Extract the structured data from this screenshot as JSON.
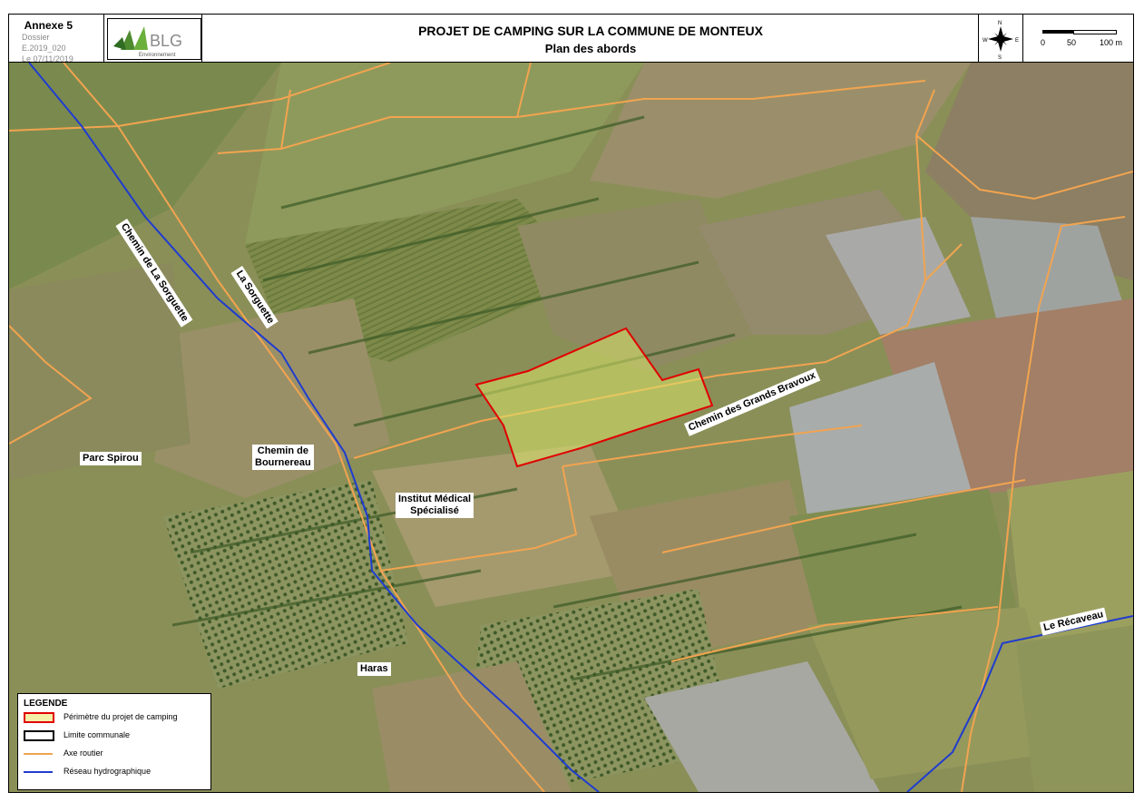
{
  "header": {
    "annex": "Annexe 5",
    "dossier": "Dossier E.2019_020",
    "date": "Le 07/11/2019",
    "logo_text": "BLG",
    "logo_subtext": "Environnement",
    "title": "PROJET DE CAMPING SUR LA COMMUNE DE MONTEUX",
    "subtitle": "Plan des abords",
    "north_icon": "compass-rose-icon",
    "scale_labels": [
      "0",
      "50",
      "100 m"
    ]
  },
  "map_labels": {
    "chemin_sorguette": "Chemin de La Sorguette",
    "la_sorguette": "La Sorguette",
    "grands_bravoux": "Chemin des Grands Bravoux",
    "parc_spirou": "Parc Spirou",
    "bournereau_1": "Chemin de",
    "bournereau_2": "Bournereau",
    "institut_1": "Institut Médical",
    "institut_2": "Spécialisé",
    "haras": "Haras",
    "recaveau": "Le Récaveau"
  },
  "legend": {
    "title": "LEGENDE",
    "items": [
      {
        "label": "Périmètre du projet de camping",
        "color": "#e00000",
        "fill": "#f5f0a8"
      },
      {
        "label": "Limite communale",
        "color": "#000000"
      },
      {
        "label": "Axe routier",
        "color": "#f2a450"
      },
      {
        "label": "Réseau hydrographique",
        "color": "#1f3ccf"
      }
    ]
  },
  "colors": {
    "road": "#f2a450",
    "water": "#1f3ccf",
    "perimeter": "#e00000",
    "perimeter_fill": "#d9e36a"
  }
}
